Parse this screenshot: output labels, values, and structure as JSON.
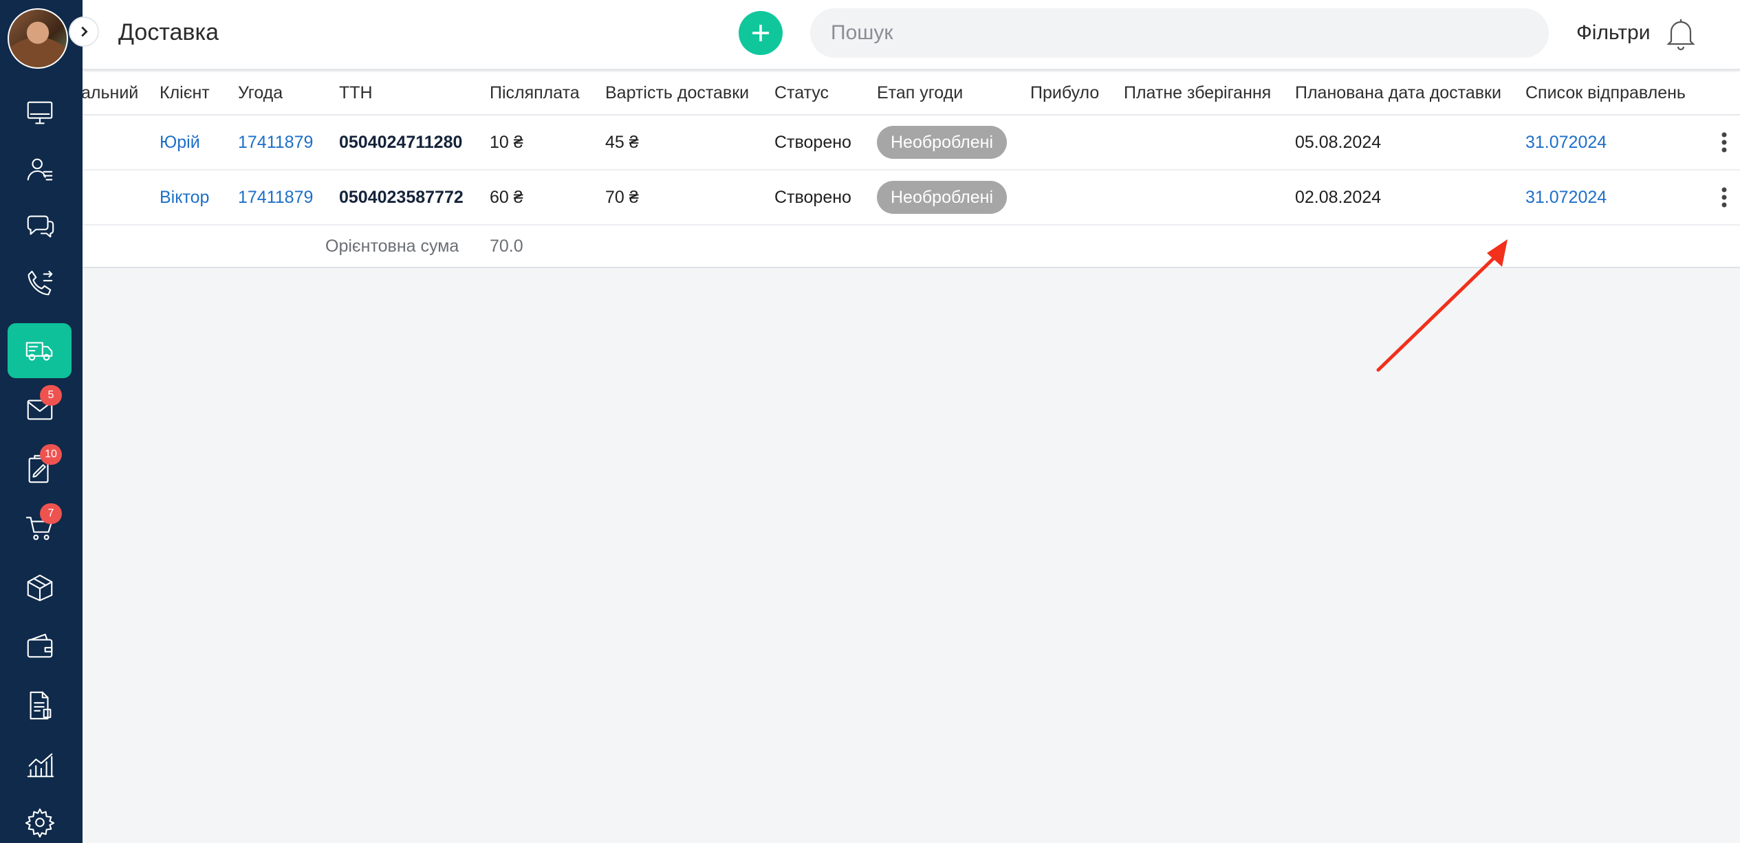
{
  "app": {
    "page_title": "Доставка",
    "search_placeholder": "Пошук",
    "filters_label": "Фільтри"
  },
  "sidebar": {
    "items": [
      {
        "icon": "monitor-icon",
        "name": "sidebar-item-desktop"
      },
      {
        "icon": "contacts-icon",
        "name": "sidebar-item-contacts"
      },
      {
        "icon": "chat-icon",
        "name": "sidebar-item-chats"
      },
      {
        "icon": "phone-icon",
        "name": "sidebar-item-calls"
      },
      {
        "icon": "truck-icon",
        "name": "sidebar-item-delivery",
        "active": true
      },
      {
        "icon": "mail-icon",
        "name": "sidebar-item-mail",
        "badge": "5"
      },
      {
        "icon": "tasks-icon",
        "name": "sidebar-item-tasks",
        "badge": "10"
      },
      {
        "icon": "cart-icon",
        "name": "sidebar-item-orders",
        "badge": "7"
      },
      {
        "icon": "box-icon",
        "name": "sidebar-item-products"
      },
      {
        "icon": "wallet-icon",
        "name": "sidebar-item-finance"
      },
      {
        "icon": "document-icon",
        "name": "sidebar-item-documents"
      },
      {
        "icon": "analytics-icon",
        "name": "sidebar-item-analytics"
      },
      {
        "icon": "gear-icon",
        "name": "sidebar-item-settings"
      }
    ]
  },
  "table": {
    "columns": [
      "альний",
      "Клієнт",
      "Угода",
      "ТТН",
      "Післяплата",
      "Вартість доставки",
      "Статус",
      "Етап угоди",
      "Прибуло",
      "Платне зберігання",
      "Планована дата доставки",
      "Список відправлень"
    ],
    "rows": [
      {
        "client": "Юрій",
        "deal": "17411879",
        "ttn": "0504024711280",
        "cod": "10 ₴",
        "delivery_cost": "45 ₴",
        "status": "Створено",
        "deal_stage": "Необроблені",
        "arrived": "",
        "paid_storage": "",
        "planned_date": "05.08.2024",
        "shipment_list": "31.072024"
      },
      {
        "client": "Віктор",
        "deal": "17411879",
        "ttn": "0504023587772",
        "cod": "60 ₴",
        "delivery_cost": "70 ₴",
        "status": "Створено",
        "deal_stage": "Необроблені",
        "arrived": "",
        "paid_storage": "",
        "planned_date": "02.08.2024",
        "shipment_list": "31.072024"
      }
    ],
    "summary": {
      "label": "Орієнтовна сума",
      "value": "70.0"
    }
  },
  "colors": {
    "sidebar": "#0f2a4a",
    "accent": "#10c79c",
    "link": "#1d6fc7",
    "badge": "#ef5350",
    "pill": "#a6a6a6",
    "annotation_arrow": "#f2301b"
  }
}
